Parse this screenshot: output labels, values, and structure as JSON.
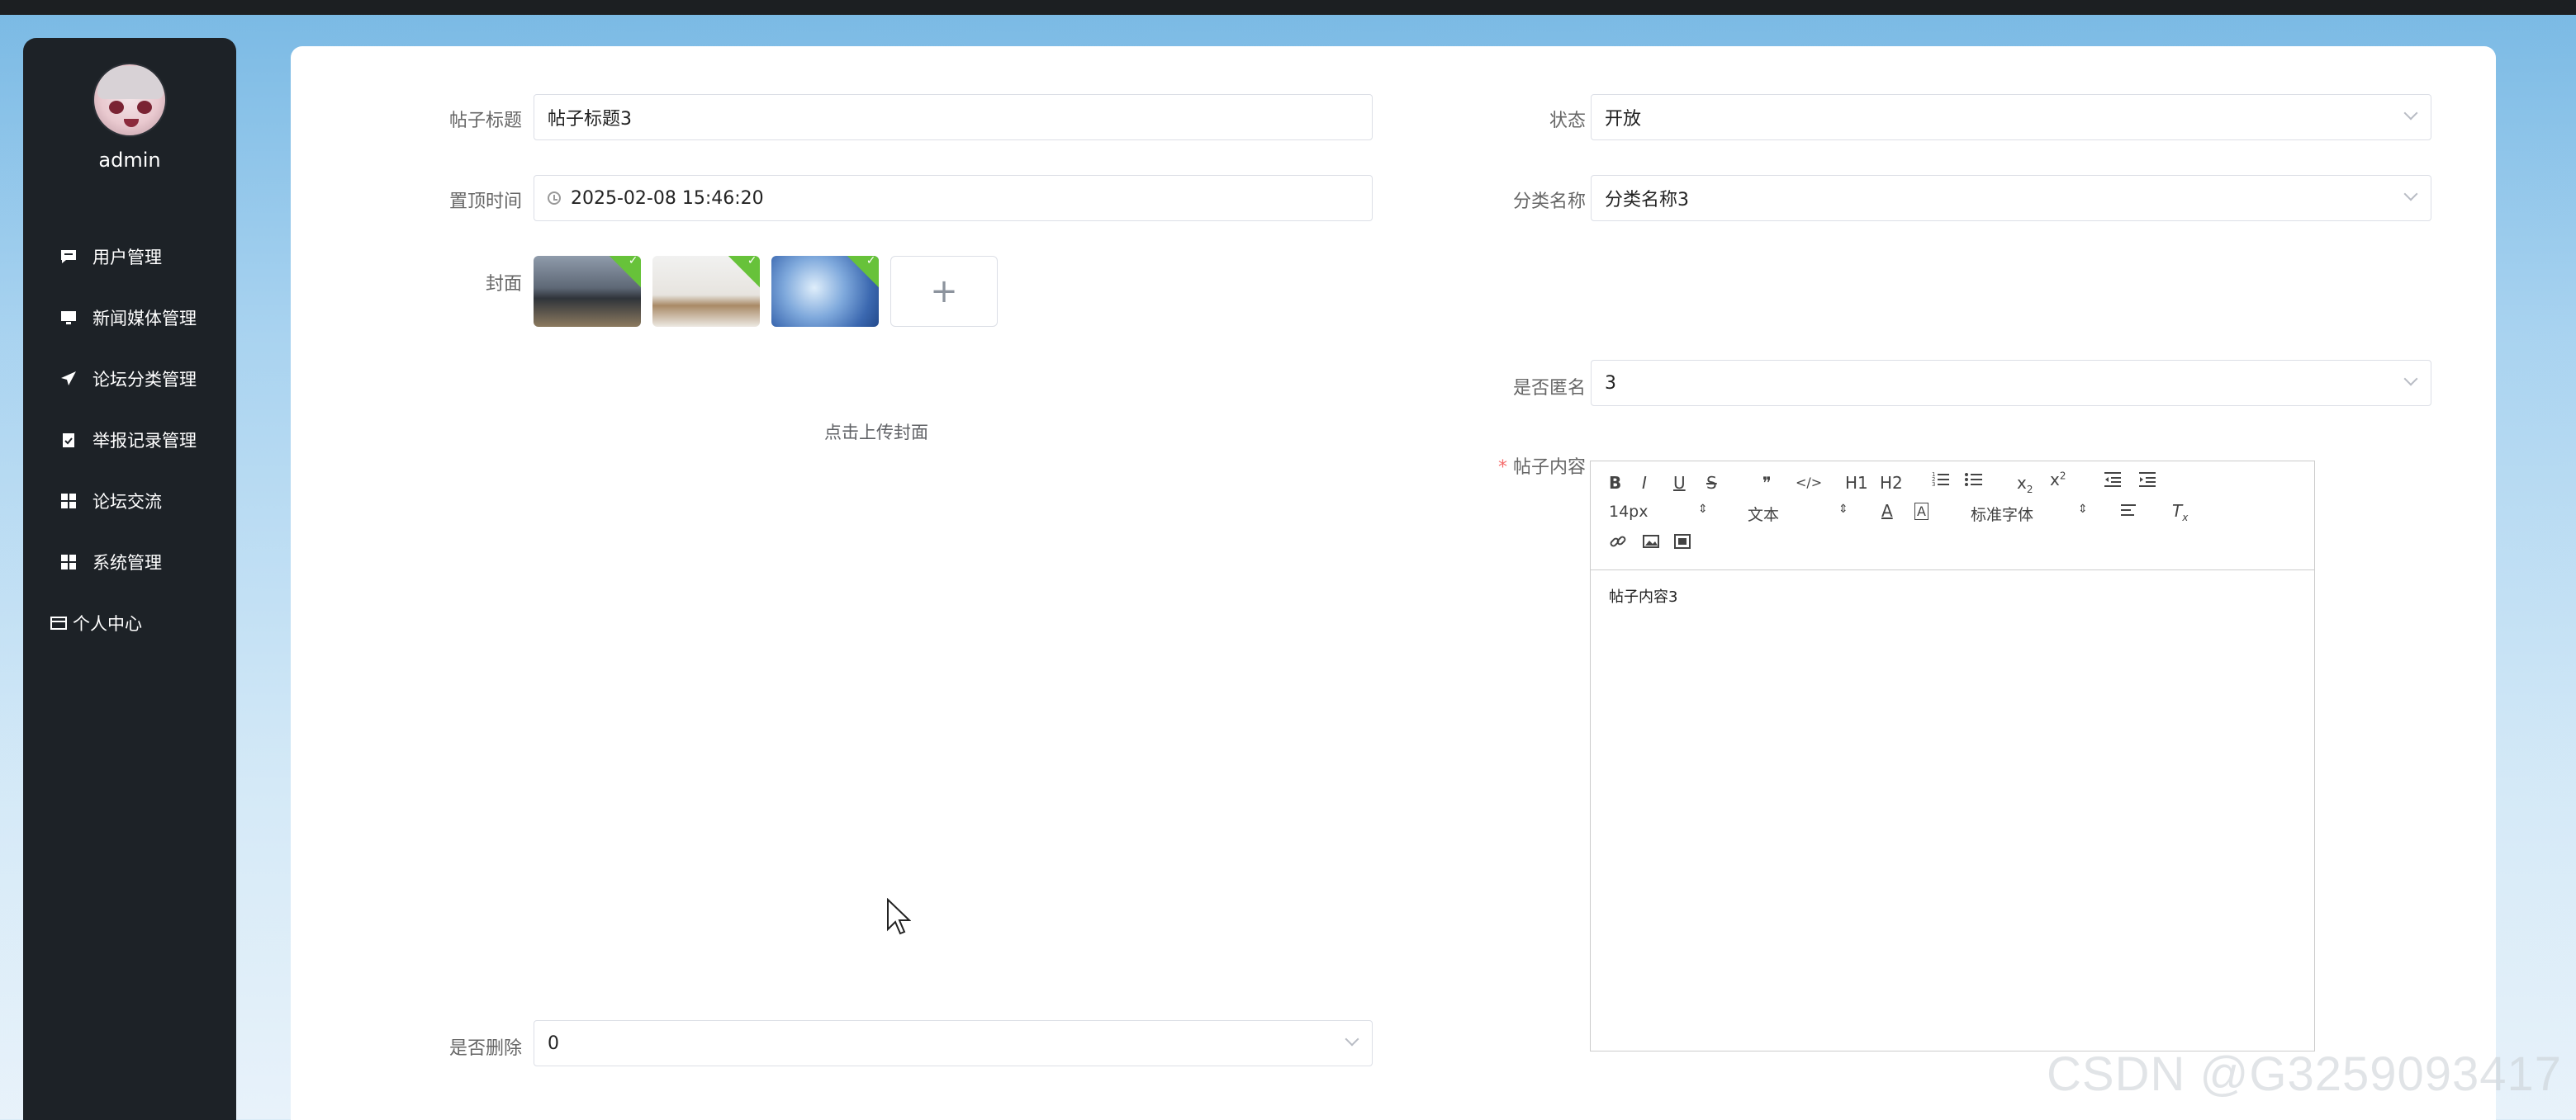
{
  "user": {
    "name": "admin"
  },
  "sidebar": {
    "items": [
      {
        "label": "用户管理",
        "icon": "chat-icon"
      },
      {
        "label": "新闻媒体管理",
        "icon": "monitor-icon"
      },
      {
        "label": "论坛分类管理",
        "icon": "paper-plane-icon"
      },
      {
        "label": "举报记录管理",
        "icon": "clipboard-icon"
      },
      {
        "label": "论坛交流",
        "icon": "grid-icon"
      },
      {
        "label": "系统管理",
        "icon": "grid-icon"
      },
      {
        "label": "个人中心",
        "icon": "card-icon"
      }
    ]
  },
  "form": {
    "title_label": "帖子标题",
    "title_value": "帖子标题3",
    "status_label": "状态",
    "status_value": "开放",
    "pin_label": "置顶时间",
    "pin_value": "2025-02-08 15:46:20",
    "category_label": "分类名称",
    "category_value": "分类名称3",
    "cover_label": "封面",
    "cover_hint": "点击上传封面",
    "anonymous_label": "是否匿名",
    "anonymous_value": "3",
    "content_label": "帖子内容",
    "content_value": "帖子内容3",
    "deleted_label": "是否删除",
    "deleted_value": "0"
  },
  "editor": {
    "font_size": "14px",
    "heading": "文本",
    "font_family": "标准字体",
    "buttons": [
      "B",
      "I",
      "U",
      "S",
      "❞",
      "</>",
      "H1",
      "H2",
      "ordered-list",
      "bullet-list",
      "subscript",
      "superscript",
      "outdent",
      "indent"
    ]
  },
  "watermark": "CSDN @G3259093417"
}
